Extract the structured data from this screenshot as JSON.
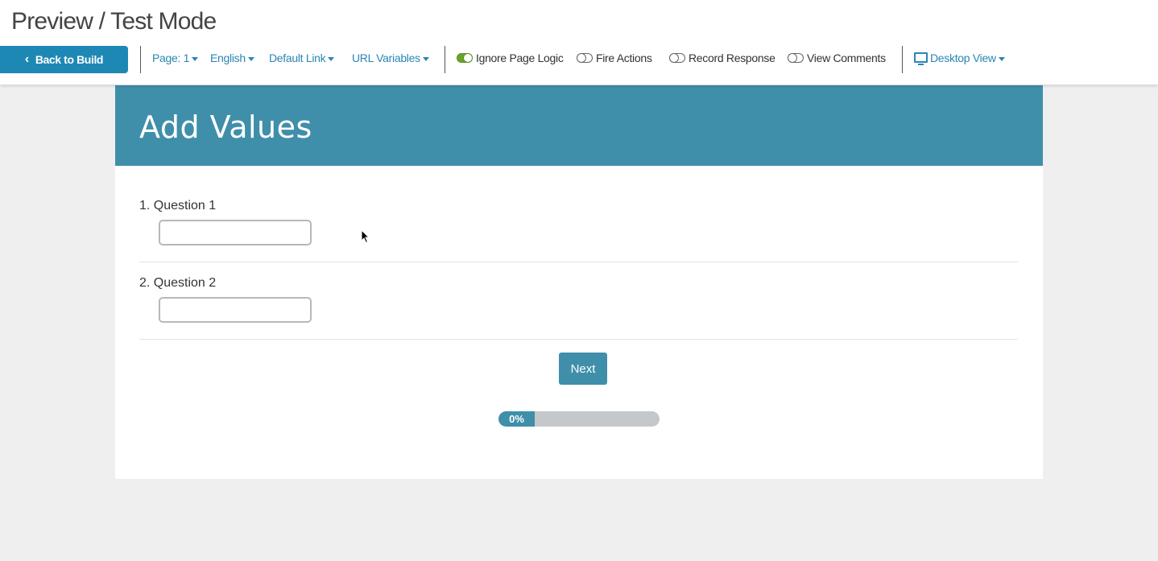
{
  "header": {
    "title": "Preview / Test Mode",
    "back_label": "Back to Build"
  },
  "menus": {
    "page": "Page: 1",
    "language": "English",
    "link": "Default Link",
    "url_vars": "URL Variables",
    "view": "Desktop View"
  },
  "toggles": {
    "ignore_page_logic": {
      "label": "Ignore Page Logic",
      "on": true
    },
    "fire_actions": {
      "label": "Fire Actions",
      "on": false
    },
    "record_response": {
      "label": "Record Response",
      "on": false
    },
    "view_comments": {
      "label": "View Comments",
      "on": false
    }
  },
  "survey": {
    "page_title": "Add Values",
    "questions": [
      {
        "label": "1. Question 1",
        "value": ""
      },
      {
        "label": "2. Question 2",
        "value": ""
      }
    ],
    "next_label": "Next",
    "progress": {
      "percent": 0,
      "text": "0%"
    }
  },
  "colors": {
    "accent": "#1e88b5",
    "header_bg": "#3f8faa",
    "toggle_on": "#6aa32a"
  }
}
